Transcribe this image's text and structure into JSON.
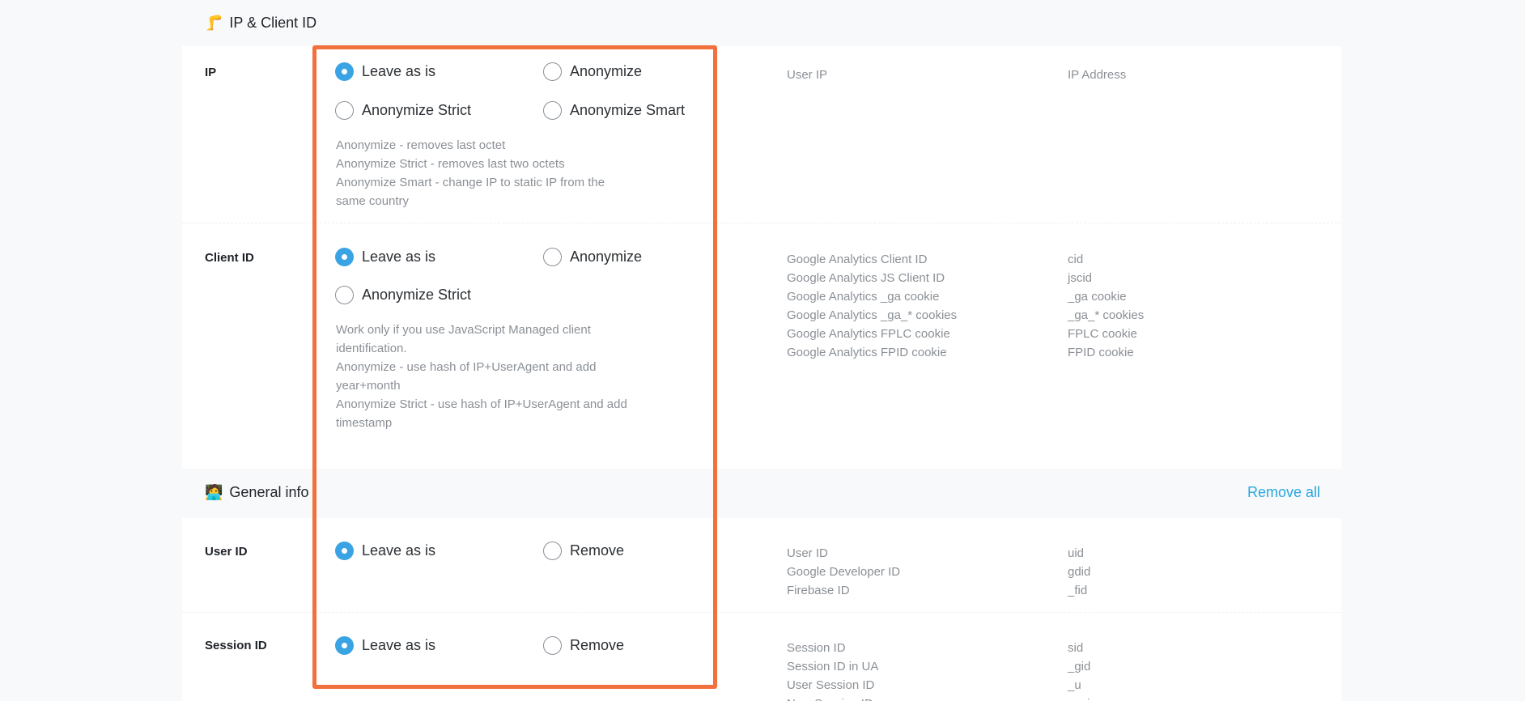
{
  "sections": {
    "ip_client": {
      "emoji": "🦵",
      "title": "IP & Client ID"
    },
    "general": {
      "emoji": "🧑‍💻",
      "title": "General info",
      "remove_all": "Remove all"
    }
  },
  "rows": {
    "ip": {
      "label": "IP",
      "options": [
        "Leave as is",
        "Anonymize",
        "Anonymize Strict",
        "Anonymize Smart"
      ],
      "selected": "Leave as is",
      "description": [
        "Anonymize - removes last octet",
        "Anonymize Strict - removes last two octets",
        "Anonymize Smart - change IP to static IP from the same country"
      ],
      "names": [
        "User IP"
      ],
      "params": [
        "IP Address"
      ]
    },
    "client_id": {
      "label": "Client ID",
      "options": [
        "Leave as is",
        "Anonymize",
        "Anonymize Strict"
      ],
      "selected": "Leave as is",
      "description": [
        "Work only if you use JavaScript Managed client identification.",
        "Anonymize - use hash of IP+UserAgent and add year+month",
        "Anonymize Strict - use hash of IP+UserAgent and add timestamp"
      ],
      "names": [
        "Google Analytics Client ID",
        "Google Analytics JS Client ID",
        "Google Analytics _ga cookie",
        "Google Analytics _ga_* cookies",
        "Google Analytics FPLC cookie",
        "Google Analytics FPID cookie"
      ],
      "params": [
        "cid",
        "jscid",
        "_ga cookie",
        "_ga_* cookies",
        "FPLC cookie",
        "FPID cookie"
      ]
    },
    "user_id": {
      "label": "User ID",
      "options": [
        "Leave as is",
        "Remove"
      ],
      "selected": "Leave as is",
      "names": [
        "User ID",
        "Google Developer ID",
        "Firebase ID"
      ],
      "params": [
        "uid",
        "gdid",
        "_fid"
      ]
    },
    "session_id": {
      "label": "Session ID",
      "options": [
        "Leave as is",
        "Remove"
      ],
      "selected": "Leave as is",
      "names": [
        "Session ID",
        "Session ID in UA",
        "User Session ID",
        "New Session ID"
      ],
      "params": [
        "sid",
        "_gid",
        "_u",
        "_nsi"
      ]
    }
  },
  "colors": {
    "accent": "#3aa3e3",
    "link": "#29a6df",
    "highlight": "#f2703c"
  }
}
